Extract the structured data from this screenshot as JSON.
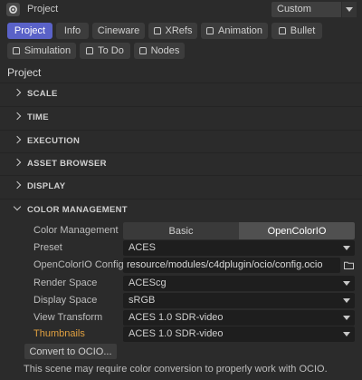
{
  "header": {
    "title": "Project",
    "icon": "gear-icon",
    "preset_value": "Custom"
  },
  "tabs": [
    {
      "label": "Project",
      "active": true,
      "locked": false
    },
    {
      "label": "Info",
      "active": false,
      "locked": false
    },
    {
      "label": "Cineware",
      "active": false,
      "locked": false
    },
    {
      "label": "XRefs",
      "active": false,
      "locked": true
    },
    {
      "label": "Animation",
      "active": false,
      "locked": true
    },
    {
      "label": "Bullet",
      "active": false,
      "locked": true
    },
    {
      "label": "Simulation",
      "active": false,
      "locked": true
    },
    {
      "label": "To Do",
      "active": false,
      "locked": true
    },
    {
      "label": "Nodes",
      "active": false,
      "locked": true
    }
  ],
  "section_title": "Project",
  "groups": [
    {
      "label": "SCALE",
      "expanded": false
    },
    {
      "label": "TIME",
      "expanded": false
    },
    {
      "label": "EXECUTION",
      "expanded": false
    },
    {
      "label": "ASSET BROWSER",
      "expanded": false
    },
    {
      "label": "DISPLAY",
      "expanded": false
    },
    {
      "label": "COLOR MANAGEMENT",
      "expanded": true
    }
  ],
  "color_management": {
    "mode_label": "Color Management",
    "mode_options": [
      "Basic",
      "OpenColorIO"
    ],
    "mode_selected": "OpenColorIO",
    "preset_label": "Preset",
    "preset_value": "ACES",
    "config_label": "OpenColorIO Config",
    "config_value": "resource/modules/c4dplugin/ocio/config.ocio",
    "render_space_label": "Render Space",
    "render_space_value": "ACEScg",
    "display_space_label": "Display Space",
    "display_space_value": "sRGB",
    "view_transform_label": "View Transform",
    "view_transform_value": "ACES 1.0 SDR-video",
    "thumbnails_label": "Thumbnails",
    "thumbnails_value": "ACES 1.0 SDR-video",
    "convert_button": "Convert to OCIO...",
    "notice": "This scene may require color conversion to properly work with OCIO."
  },
  "colors": {
    "accent": "#5a62c8",
    "background": "#2b2b2b",
    "highlight_label": "#e0a040"
  }
}
